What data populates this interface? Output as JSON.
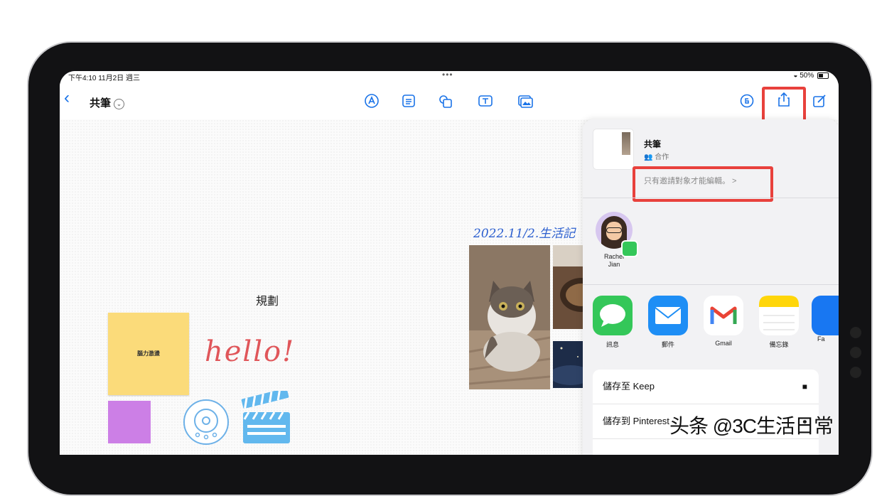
{
  "status_bar": {
    "time": "下午4:10  11月2日 週三",
    "dots": "•••",
    "battery": "50%"
  },
  "toolbar": {
    "title": "共筆"
  },
  "canvas": {
    "plan_label": "規劃",
    "sticky_note_text": "腦力激盪",
    "hello_text": "hello!",
    "handwriting_text": "2022.11/2.生活記"
  },
  "share_sheet": {
    "doc_title": "共筆",
    "doc_subtitle": "合作",
    "permission": "只有邀請對象才能編輯。 >",
    "contact": {
      "first": "Rachel",
      "last": "Jian"
    },
    "apps": [
      {
        "label": "訊息",
        "icon": "messages-icon",
        "color": "#34c759"
      },
      {
        "label": "郵件",
        "icon": "mail-icon",
        "color": "#1e8ef5"
      },
      {
        "label": "Gmail",
        "icon": "gmail-icon",
        "color": "#ea4335"
      },
      {
        "label": "備忘錄",
        "icon": "notes-icon",
        "color": "#ffd60a"
      },
      {
        "label": "Fa",
        "icon": "facebook-icon",
        "color": "#1877f2"
      }
    ],
    "actions": [
      {
        "label": "儲存至 Keep",
        "icon": "bookmark-icon"
      },
      {
        "label": "儲存到 Pinterest",
        "icon": "pinterest-icon"
      }
    ]
  },
  "watermark": "头条 @3C生活日常",
  "colors": {
    "accent": "#1a73e8",
    "highlight": "#e8413c",
    "sticky_yellow": "#fbdb7a",
    "sticky_purple": "#cc7fe6"
  }
}
